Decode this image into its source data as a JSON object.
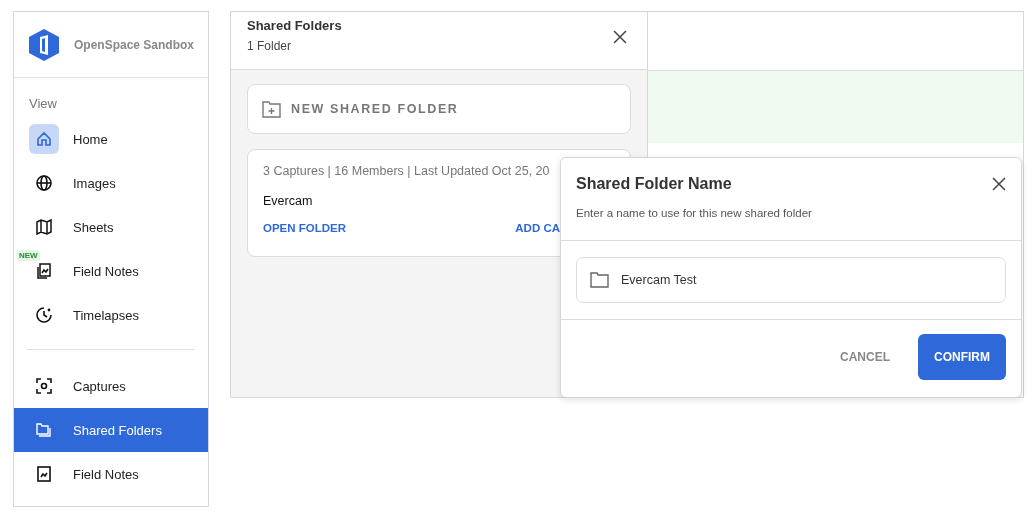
{
  "sidebar": {
    "brand": "OpenSpace Sandbox",
    "section_label": "View",
    "items": [
      {
        "label": "Home",
        "selected": false,
        "highlighted": true
      },
      {
        "label": "Images",
        "selected": false,
        "highlighted": false
      },
      {
        "label": "Sheets",
        "selected": false,
        "highlighted": false
      },
      {
        "label": "Field Notes",
        "selected": false,
        "highlighted": false,
        "badge": "NEW"
      },
      {
        "label": "Timelapses",
        "selected": false,
        "highlighted": false
      }
    ],
    "bottom_items": [
      {
        "label": "Captures",
        "selected": false,
        "highlighted": false
      },
      {
        "label": "Shared Folders",
        "selected": true,
        "highlighted": false
      },
      {
        "label": "Field Notes",
        "selected": false,
        "highlighted": false
      }
    ]
  },
  "panel": {
    "title": "Shared Folders",
    "subtitle": "1 Folder",
    "new_button": "NEW SHARED FOLDER",
    "folders": [
      {
        "meta": "3 Captures | 16 Members | Last Updated Oct 25, 20",
        "name": "Evercam",
        "open": "OPEN FOLDER",
        "add": "ADD CA"
      }
    ]
  },
  "dialog": {
    "title": "Shared Folder Name",
    "description": "Enter a name to use for this new shared folder",
    "value": "Evercam Test",
    "cancel": "CANCEL",
    "confirm": "CONFIRM"
  }
}
